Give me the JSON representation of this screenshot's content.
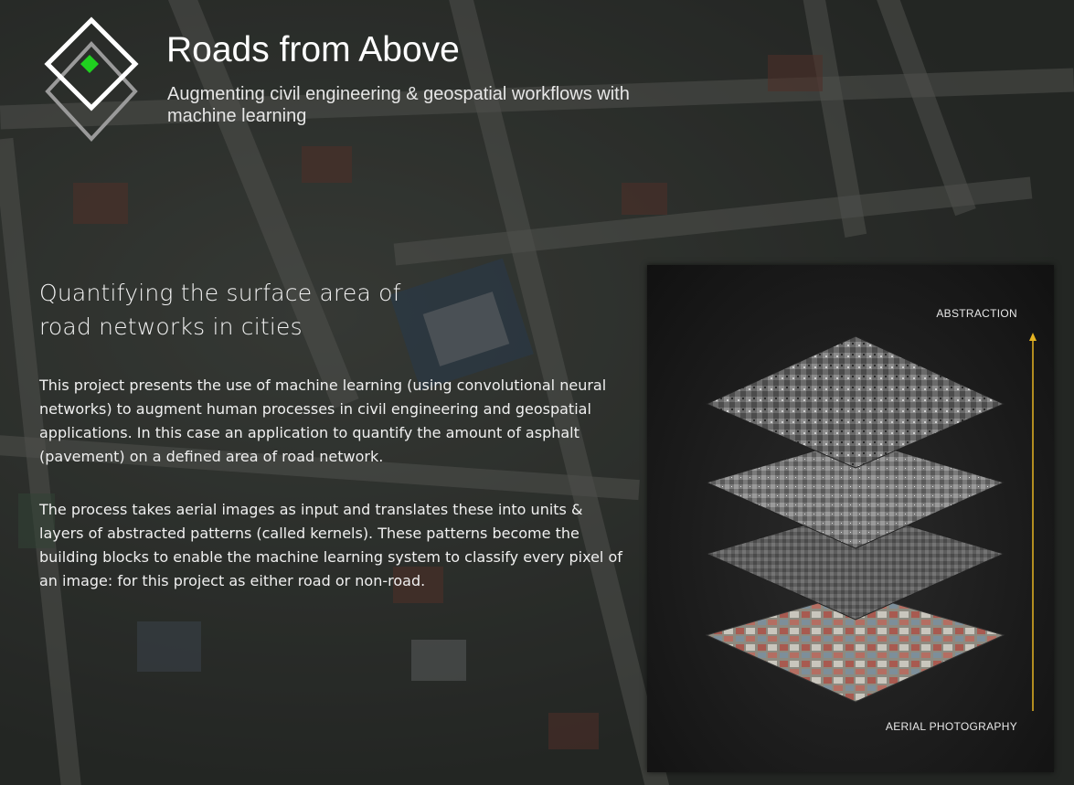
{
  "header": {
    "title": "Roads from Above",
    "subtitle": "Augmenting civil engineering & geospatial workflows with machine learning"
  },
  "main": {
    "heading": "Quantifying the surface area of road networks in cities",
    "paragraphs": [
      "This project presents the use of machine learning (using convolutional neural networks) to augment human processes in civil engineering and geospatial applications. In this case an application to quantify the amount of asphalt (pavement) on a defined area of road network.",
      "The process takes aerial images as input and translates these into units & layers of abstracted patterns (called kernels). These patterns become the building blocks to enable the machine learning system to classify every pixel of an image: for this project as either road or non-road."
    ]
  },
  "figure": {
    "top_label": "ABSTRACTION",
    "bottom_label": "AERIAL PHOTOGRAPHY",
    "layers": 4,
    "arrow_color": "#e6b422"
  },
  "colors": {
    "logo_accent": "#1fd11f",
    "logo_outline": "#ffffff"
  },
  "icons": {
    "logo": "diamond-logo-icon"
  }
}
